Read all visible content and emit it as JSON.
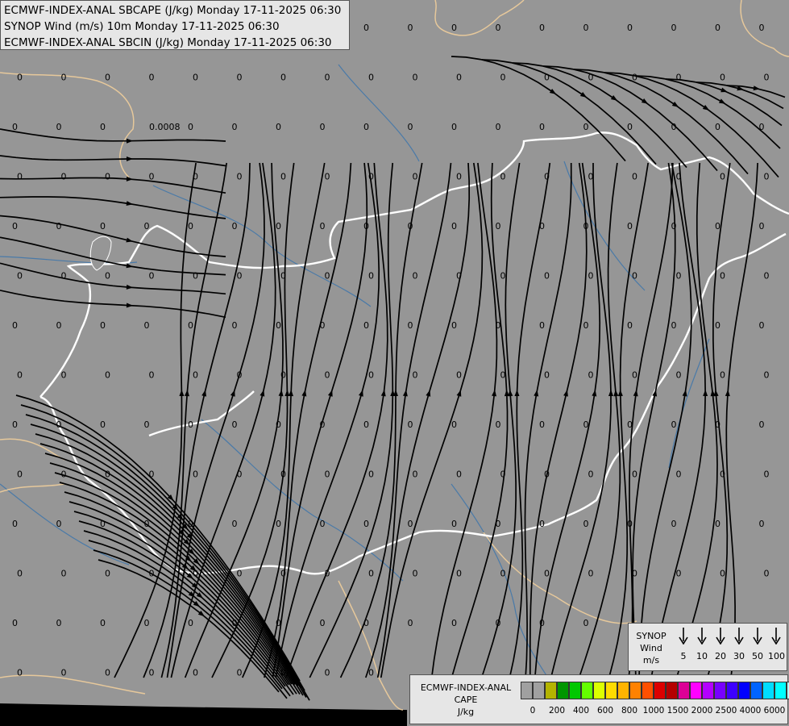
{
  "titles": {
    "line1": "ECMWF-INDEX-ANAL SBCAPE (J/kg) Monday 17-11-2025 06:30",
    "line2": "SYNOP Wind (m/s) 10m Monday 17-11-2025 06:30",
    "line3": "ECMWF-INDEX-ANAL SBCIN (J/kg) Monday 17-11-2025 06:30"
  },
  "field_values": {
    "zero": "0",
    "special": "0.0008"
  },
  "wind_legend": {
    "title_lines": [
      "SYNOP",
      "Wind",
      "m/s"
    ],
    "speeds": [
      "5",
      "10",
      "20",
      "30",
      "50",
      "100"
    ]
  },
  "cape_legend": {
    "title_lines": [
      "ECMWF-INDEX-ANAL",
      "CAPE",
      "J/kg"
    ],
    "colors": [
      "#a0a0a0",
      "#a0a0a0",
      "#b4b400",
      "#009600",
      "#00c800",
      "#64ff00",
      "#dcff00",
      "#ffdc00",
      "#ffb400",
      "#ff8200",
      "#ff5000",
      "#dc0000",
      "#b40000",
      "#dc0096",
      "#ff00ff",
      "#b400ff",
      "#7800ff",
      "#3c00ff",
      "#0000ff",
      "#0064ff",
      "#00dcff",
      "#00ffff",
      "#b4ffff",
      "#ffffff"
    ],
    "ticks": [
      "0",
      "200",
      "400",
      "600",
      "800",
      "1000",
      "1500",
      "2000",
      "2500",
      "4000",
      "6000"
    ]
  },
  "colors": {
    "background": "#969696",
    "border": "#e6c89b",
    "country_border": "#ffffff",
    "river": "#4a7aa8"
  }
}
